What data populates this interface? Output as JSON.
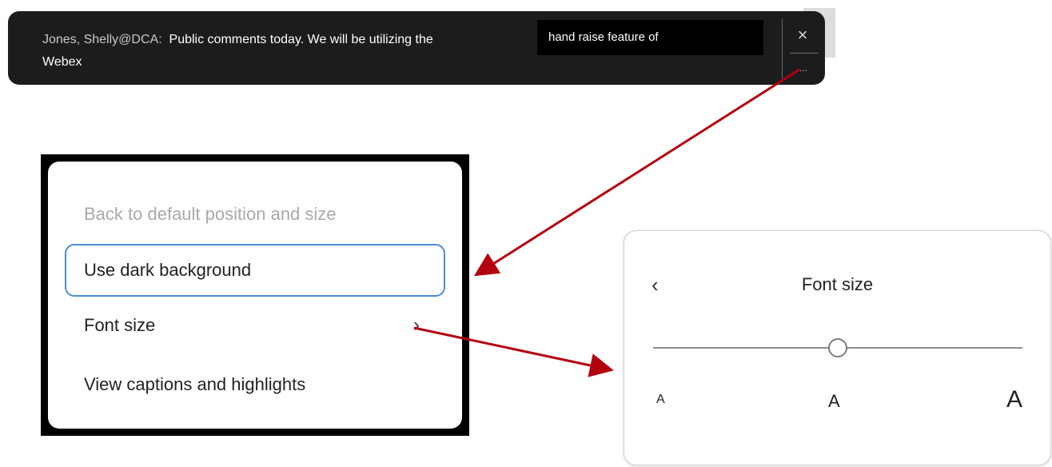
{
  "caption": {
    "speaker": "Jones, Shelly@DCA:",
    "text_line1": "Public comments today. We will be utilizing the",
    "text_overlay": "hand raise feature of",
    "text_line2": "Webex",
    "close_glyph": "×",
    "more_glyph": "..."
  },
  "menu": {
    "items": [
      {
        "label": "Back to default position and size",
        "state": "disabled"
      },
      {
        "label": "Use dark background",
        "state": "focused"
      },
      {
        "label": "Font size",
        "state": "normal",
        "chevron": "›"
      },
      {
        "label": "View captions and highlights",
        "state": "normal"
      }
    ]
  },
  "font_size_panel": {
    "back_glyph": "‹",
    "title": "Font size",
    "slider_value": 0.5,
    "size_labels": [
      "A",
      "A",
      "A"
    ]
  },
  "colors": {
    "caption_bg": "#1c1c1e",
    "focus_border": "#4d8bd6",
    "arrow": "#b3000f"
  }
}
